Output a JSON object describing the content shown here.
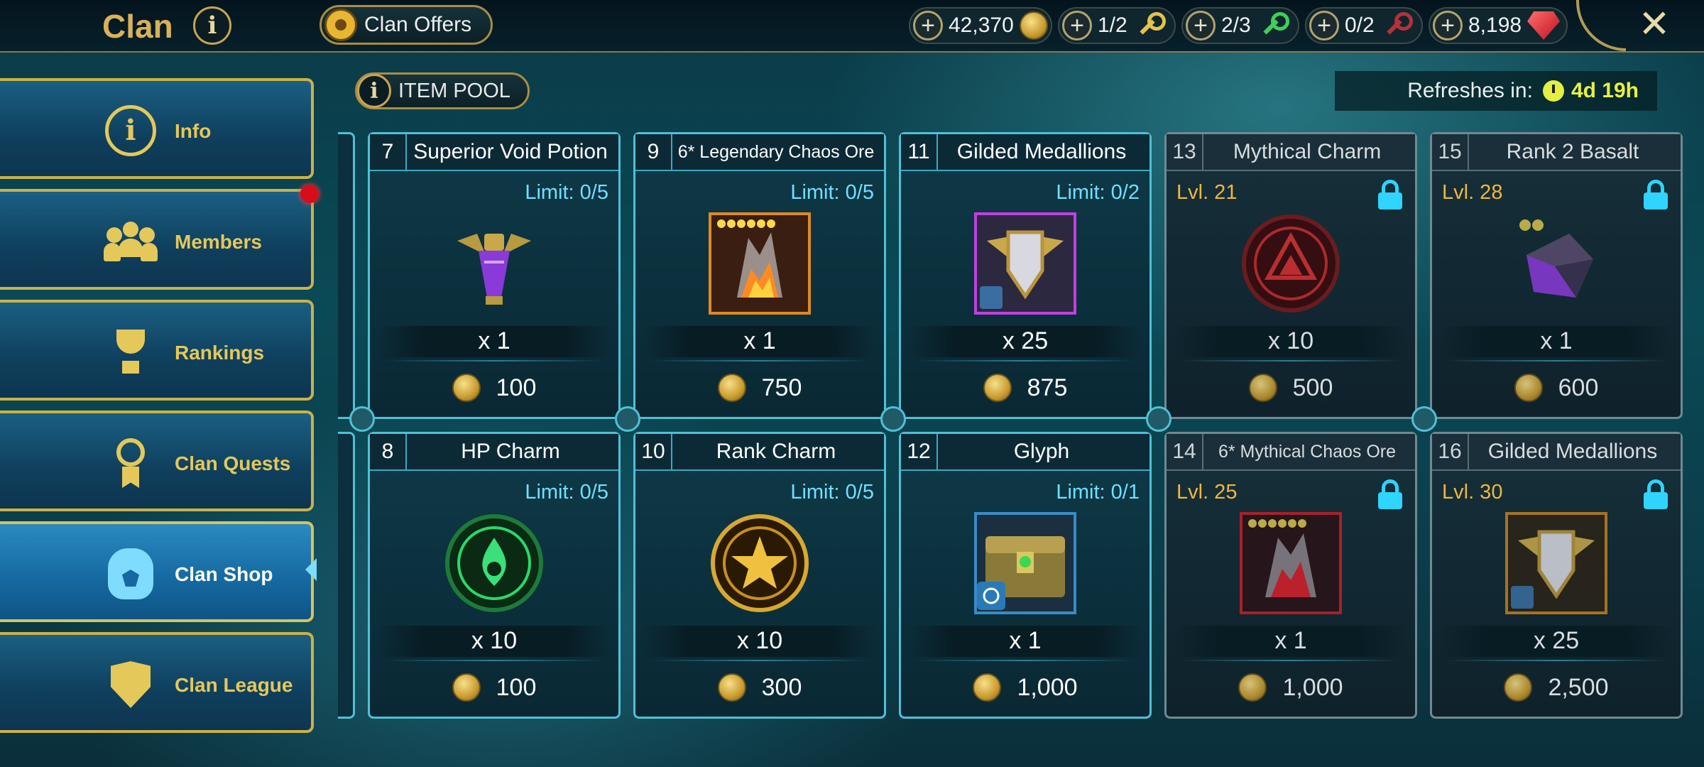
{
  "header": {
    "title": "Clan",
    "info_symbol": "i",
    "clan_offers_label": "Clan Offers",
    "close_symbol": "✕",
    "resources": [
      {
        "icon": "coin-icon",
        "value": "42,370",
        "color": "#e0b84a"
      },
      {
        "icon": "gold-key-icon",
        "value": "1/2",
        "color": "#e5c24a"
      },
      {
        "icon": "green-key-icon",
        "value": "2/3",
        "color": "#3ecf5a"
      },
      {
        "icon": "red-key-icon",
        "value": "0/2",
        "color": "#b8303a"
      },
      {
        "icon": "gem-icon",
        "value": "8,198",
        "color": "#e2323a"
      }
    ],
    "plus_symbol": "+"
  },
  "sidebar": {
    "items": [
      {
        "label": "Info",
        "icon": "info-icon",
        "active": false
      },
      {
        "label": "Members",
        "icon": "members-icon",
        "active": false,
        "notification": true
      },
      {
        "label": "Rankings",
        "icon": "trophy-icon",
        "active": false
      },
      {
        "label": "Clan Quests",
        "icon": "medal-icon",
        "active": false
      },
      {
        "label": "Clan Shop",
        "icon": "bag-icon",
        "active": true
      },
      {
        "label": "Clan League",
        "icon": "shield-icon",
        "active": false
      }
    ]
  },
  "shop": {
    "item_pool_label": "ITEM POOL",
    "refresh_label": "Refreshes in:",
    "refresh_time": "4d 19h",
    "cards": [
      {
        "num": "7",
        "name": "Superior Void Potion",
        "limit": "Limit: 0/5",
        "qty": "x 1",
        "price": "100",
        "locked": false,
        "icon": "void-potion-icon",
        "frame": "none"
      },
      {
        "num": "9",
        "name": "6* Legendary Chaos Ore",
        "limit": "Limit: 0/5",
        "qty": "x 1",
        "price": "750",
        "locked": false,
        "icon": "chaos-ore-icon",
        "frame": "#e08a20"
      },
      {
        "num": "11",
        "name": "Gilded Medallions",
        "limit": "Limit: 0/2",
        "qty": "x 25",
        "price": "875",
        "locked": false,
        "icon": "medallion-icon",
        "frame": "#c040e0"
      },
      {
        "num": "13",
        "name": "Mythical Charm",
        "level": "Lvl. 21",
        "qty": "x 10",
        "price": "500",
        "locked": true,
        "icon": "mythical-charm-icon",
        "frame": "none"
      },
      {
        "num": "15",
        "name": "Rank 2 Basalt",
        "level": "Lvl. 28",
        "qty": "x 1",
        "price": "600",
        "locked": true,
        "icon": "basalt-icon",
        "frame": "none"
      },
      {
        "num": "8",
        "name": "HP Charm",
        "limit": "Limit: 0/5",
        "qty": "x 10",
        "price": "100",
        "locked": false,
        "icon": "hp-charm-icon",
        "frame": "none"
      },
      {
        "num": "10",
        "name": "Rank Charm",
        "limit": "Limit: 0/5",
        "qty": "x 10",
        "price": "300",
        "locked": false,
        "icon": "rank-charm-icon",
        "frame": "none"
      },
      {
        "num": "12",
        "name": "Glyph",
        "limit": "Limit: 0/1",
        "qty": "x 1",
        "price": "1,000",
        "locked": false,
        "icon": "glyph-chest-icon",
        "frame": "#3a8ac8"
      },
      {
        "num": "14",
        "name": "6* Mythical Chaos Ore",
        "level": "Lvl. 25",
        "qty": "x 1",
        "price": "1,000",
        "locked": true,
        "icon": "mythical-chaos-ore-icon",
        "frame": "#c0202a"
      },
      {
        "num": "16",
        "name": "Gilded Medallions",
        "level": "Lvl. 30",
        "qty": "x 25",
        "price": "2,500",
        "locked": true,
        "icon": "medallion-icon",
        "frame": "#c08020"
      }
    ]
  },
  "colors": {
    "accent_gold": "#d8b15a",
    "limit_cyan": "#6fe0ff",
    "level_orange": "#f0b640",
    "active_nav": "#1568a0"
  }
}
